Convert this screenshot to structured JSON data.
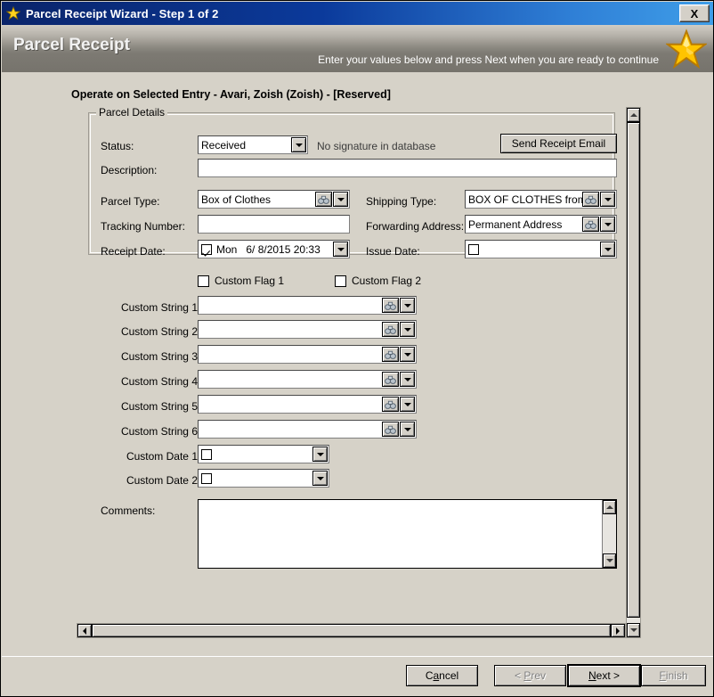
{
  "window": {
    "title": "Parcel Receipt Wizard - Step 1 of 2",
    "title_icon": "star-icon",
    "close_label": "X"
  },
  "banner": {
    "title": "Parcel Receipt",
    "subtitle": "Enter your values below and press Next when you are ready to continue",
    "icon": "star-icon"
  },
  "content": {
    "entry_heading": "Operate on Selected Entry - Avari, Zoish (Zoish) - [Reserved]"
  },
  "parcel_details": {
    "group_title": "Parcel Details",
    "status_label": "Status:",
    "status_value": "Received",
    "signature_note": "No signature in database",
    "send_email_label": "Send Receipt Email",
    "description_label": "Description:",
    "description_value": "",
    "parcel_type_label": "Parcel Type:",
    "parcel_type_value": "Box of Clothes",
    "shipping_type_label": "Shipping Type:",
    "shipping_type_value": "BOX OF CLOTHES from f",
    "tracking_number_label": "Tracking Number:",
    "tracking_number_value": "",
    "forwarding_address_label": "Forwarding Address:",
    "forwarding_address_value": "Permanent Address",
    "receipt_date_label": "Receipt Date:",
    "receipt_date_value": "Mon   6/ 8/2015 20:33",
    "receipt_date_checked": true,
    "issue_date_label": "Issue Date:",
    "issue_date_value": "",
    "issue_date_checked": false
  },
  "custom": {
    "flag1_label": "Custom Flag 1",
    "flag1_checked": false,
    "flag2_label": "Custom Flag 2",
    "flag2_checked": false,
    "strings": [
      {
        "label": "Custom String 1",
        "value": ""
      },
      {
        "label": "Custom String 2",
        "value": ""
      },
      {
        "label": "Custom String 3",
        "value": ""
      },
      {
        "label": "Custom String 4",
        "value": ""
      },
      {
        "label": "Custom String 5",
        "value": ""
      },
      {
        "label": "Custom String 6",
        "value": ""
      }
    ],
    "dates": [
      {
        "label": "Custom Date 1",
        "value": "",
        "checked": false
      },
      {
        "label": "Custom Date 2",
        "value": "",
        "checked": false
      }
    ],
    "comments_label": "Comments:",
    "comments_value": ""
  },
  "footer": {
    "cancel": {
      "pre": "C",
      "mnemonic": "a",
      "post": "ncel",
      "disabled": false
    },
    "prev": {
      "pre": "< ",
      "mnemonic": "P",
      "post": "rev",
      "disabled": true
    },
    "next": {
      "pre": "",
      "mnemonic": "N",
      "post": "ext >",
      "disabled": false
    },
    "finish": {
      "pre": "",
      "mnemonic": "F",
      "post": "inish",
      "disabled": true
    }
  },
  "colors": {
    "titlebar_start": "#0a246a",
    "titlebar_end": "#3f9ee8",
    "face": "#d6d2c8",
    "banner_text": "#ffffff",
    "star": "#ffcc00"
  }
}
